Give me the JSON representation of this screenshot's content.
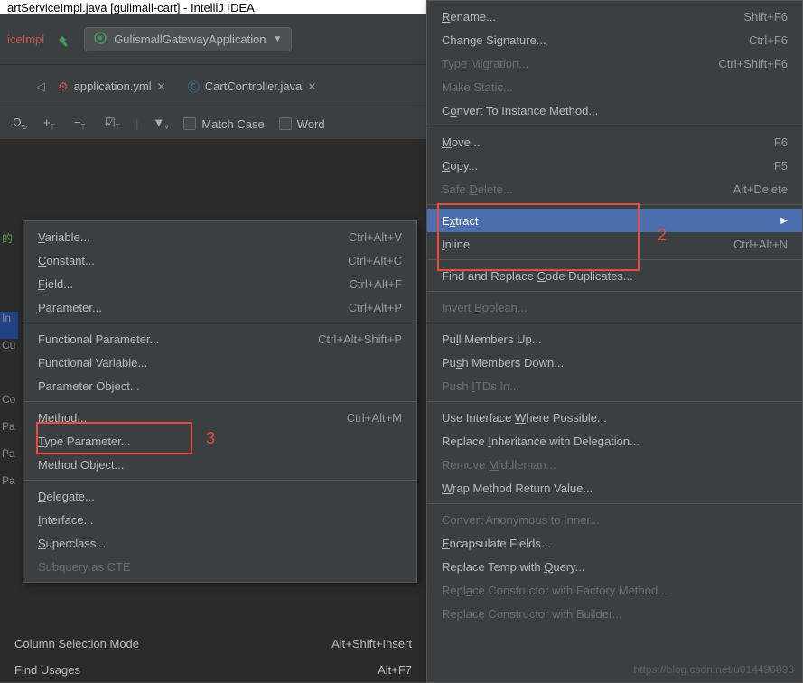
{
  "title_bar": "artServiceImpl.java [gulimall-cart] - IntelliJ IDEA",
  "breadcrumb": "iceImpl",
  "run_config": "GulismallGatewayApplication",
  "tabs": [
    {
      "icon": "yml",
      "label": "application.yml"
    },
    {
      "icon": "java",
      "label": "CartController.java"
    }
  ],
  "find_toolbar": {
    "match_case": "Match Case",
    "words": "Word"
  },
  "gutter_lines": [
    "的",
    "",
    "",
    "In",
    "Cu",
    "",
    "Co",
    "Pa",
    "Pa",
    "Pa"
  ],
  "bottom_menu": [
    {
      "label": "Column Selection Mode",
      "shortcut": "Alt+Shift+Insert"
    },
    {
      "label": "Find Usages",
      "shortcut": "Alt+F7"
    }
  ],
  "refactor_menu": [
    {
      "label": "Rename...",
      "shortcut": "Shift+F6",
      "mn": "R"
    },
    {
      "label": "Change Signature...",
      "shortcut": "Ctrl+F6"
    },
    {
      "label": "Type Migration...",
      "shortcut": "Ctrl+Shift+F6",
      "disabled": true
    },
    {
      "label": "Make Static...",
      "disabled": true
    },
    {
      "label": "Convert To Instance Method...",
      "mn": "o"
    },
    {
      "separator": true
    },
    {
      "label": "Move...",
      "shortcut": "F6",
      "mn": "M"
    },
    {
      "label": "Copy...",
      "shortcut": "F5",
      "mn": "C"
    },
    {
      "label": "Safe Delete...",
      "shortcut": "Alt+Delete",
      "mn": "D",
      "disabled": true
    },
    {
      "separator": true
    },
    {
      "label": "Extract",
      "highlighted": true,
      "submenu": true,
      "mn": "x"
    },
    {
      "label": "Inline",
      "shortcut": "Ctrl+Alt+N",
      "mn": "I"
    },
    {
      "separator": true
    },
    {
      "label": "Find and Replace Code Duplicates...",
      "mn": "C"
    },
    {
      "separator": true
    },
    {
      "label": "Invert Boolean...",
      "disabled": true,
      "mn": "B"
    },
    {
      "separator": true
    },
    {
      "label": "Pull Members Up...",
      "mn": "l"
    },
    {
      "label": "Push Members Down...",
      "mn": "s"
    },
    {
      "label": "Push ITDs In...",
      "disabled": true,
      "mn": "I"
    },
    {
      "separator": true
    },
    {
      "label": "Use Interface Where Possible...",
      "mn": "W"
    },
    {
      "label": "Replace Inheritance with Delegation...",
      "mn": "I"
    },
    {
      "label": "Remove Middleman...",
      "disabled": true,
      "mn": "M"
    },
    {
      "label": "Wrap Method Return Value...",
      "mn": "W"
    },
    {
      "separator": true
    },
    {
      "label": "Convert Anonymous to Inner...",
      "disabled": true
    },
    {
      "label": "Encapsulate Fields...",
      "mn": "E"
    },
    {
      "label": "Replace Temp with Query...",
      "mn": "Q"
    },
    {
      "label": "Replace Constructor with Factory Method...",
      "disabled": true,
      "mn": "a"
    },
    {
      "label": "Replace Constructor with Builder...",
      "disabled": true
    }
  ],
  "extract_submenu": [
    {
      "label": "Variable...",
      "shortcut": "Ctrl+Alt+V",
      "mn": "V"
    },
    {
      "label": "Constant...",
      "shortcut": "Ctrl+Alt+C",
      "mn": "C"
    },
    {
      "label": "Field...",
      "shortcut": "Ctrl+Alt+F",
      "mn": "F"
    },
    {
      "label": "Parameter...",
      "shortcut": "Ctrl+Alt+P",
      "mn": "P"
    },
    {
      "separator": true
    },
    {
      "label": "Functional Parameter...",
      "shortcut": "Ctrl+Alt+Shift+P"
    },
    {
      "label": "Functional Variable..."
    },
    {
      "label": "Parameter Object..."
    },
    {
      "separator": true
    },
    {
      "label": "Method...",
      "shortcut": "Ctrl+Alt+M",
      "mn": "M"
    },
    {
      "label": "Type Parameter...",
      "mn": "T"
    },
    {
      "label": "Method Object..."
    },
    {
      "separator": true
    },
    {
      "label": "Delegate...",
      "mn": "D"
    },
    {
      "label": "Interface...",
      "mn": "I"
    },
    {
      "label": "Superclass...",
      "mn": "S"
    },
    {
      "label": "Subquery as CTE",
      "disabled": true
    }
  ],
  "annotations": {
    "num2": "2",
    "num3": "3"
  },
  "watermark": "https://blog.csdn.net/u014496893"
}
